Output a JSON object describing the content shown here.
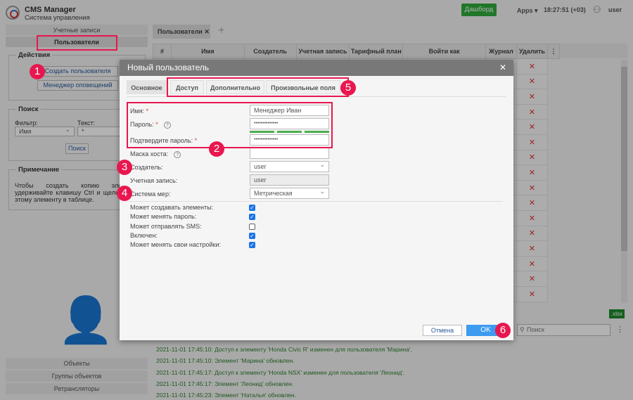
{
  "header": {
    "app_title": "CMS Manager",
    "app_subtitle": "Система управления",
    "dashboard_label": "Дашборд",
    "apps_label": "Apps",
    "time": "18:27:51 (+03)",
    "user": "user"
  },
  "sidebar": {
    "accounts_label": "Учетные записи",
    "users_label": "Пользователи",
    "actions": {
      "title": "Действия",
      "create_user": "Создать пользователя",
      "notification_manager": "Менеджер оповещений"
    },
    "search": {
      "title": "Поиск",
      "filter_label": "Фильтр:",
      "filter_value": "Имя",
      "text_label": "Текст:",
      "text_value": "*",
      "search_button": "Поиск"
    },
    "note": {
      "title": "Примечание",
      "text": "Чтобы создать копию элемента, удерживайте клавишу Ctrl и щелкните по этому элементу в таблице."
    },
    "bottom_nav": [
      "Объекты",
      "Группы объектов",
      "Ретрансляторы"
    ]
  },
  "tabs": {
    "active": "Пользователи",
    "add": "+"
  },
  "table": {
    "columns": [
      "#",
      "Имя",
      "Создатель",
      "Учетная запись",
      "Тарифный план",
      "Войти как",
      "Журнал",
      "Удалить"
    ],
    "row_count": 16,
    "delete_glyph": "✕",
    "export_label": ".xlsx",
    "search_placeholder": "Поиск"
  },
  "log": [
    "2021-11-01 17:45:10: Доступ к элементу 'Honda Civic R' изменен для пользователя 'Марина'.",
    "2021-11-01 17:45:10: Элемент 'Марина' обновлен.",
    "2021-11-01 17:45:17: Доступ к элементу 'Honda NSX' изменен для пользователя 'Леонид'.",
    "2021-11-01 17:45:17: Элемент 'Леонид' обновлен.",
    "2021-11-01 17:45:23: Элемент 'Наталья' обновлен."
  ],
  "modal": {
    "title": "Новый пользователь",
    "tabs": [
      "Основное",
      "Доступ",
      "Дополнительно",
      "Произвольные поля"
    ],
    "fields": {
      "name_label": "Имя:",
      "name_value": "Менеджер Иван",
      "password_label": "Пароль:",
      "password_value": "••••••••••••••",
      "confirm_label": "Подтвердите пароль:",
      "confirm_value": "••••••••••••••",
      "host_mask_label": "Маска хоста:",
      "creator_label": "Создатель:",
      "creator_value": "user",
      "account_label": "Учетная запись:",
      "account_value": "user",
      "units_label": "Система мер:",
      "units_value": "Метрическая",
      "required_mark": "*",
      "help_glyph": "?"
    },
    "checkboxes": [
      {
        "label": "Может создавать элементы:",
        "checked": true
      },
      {
        "label": "Может менять пароль:",
        "checked": true
      },
      {
        "label": "Может отправлять SMS:",
        "checked": false
      },
      {
        "label": "Включен:",
        "checked": true
      },
      {
        "label": "Может менять свои настройки:",
        "checked": true
      }
    ],
    "cancel": "Отмена",
    "ok": "OK"
  },
  "callouts": [
    "1",
    "2",
    "3",
    "4",
    "5",
    "6"
  ],
  "colors": {
    "accent": "#e8174f",
    "dashboard": "#2eaa3c",
    "ok": "#3d9bf0"
  }
}
